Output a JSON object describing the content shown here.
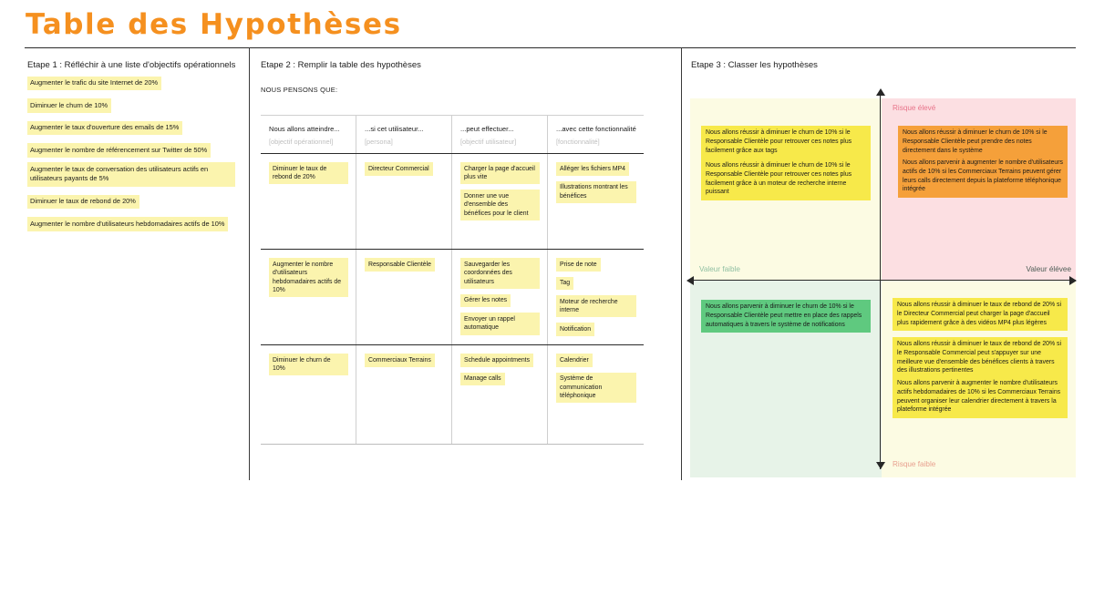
{
  "page": {
    "title": "Table des Hypothèses",
    "title_color": "#f5901f"
  },
  "step1": {
    "heading": "Etape 1 : Réfléchir à une liste d'objectifs opérationnels",
    "goals": [
      "Augmenter le trafic du site Internet de 20%",
      "Diminuer le churn de 10%",
      "Augmenter le taux d'ouverture des emails de 15%",
      "Augmenter le nombre de référencement sur Twitter de 50%",
      "Augmenter le taux de conversation des utilisateurs actifs en utilisateurs payants de 5%",
      "Diminuer le taux de rebond de 20%",
      "Augmenter le nombre d'utilisateurs hebdomadaires actifs de 10%"
    ]
  },
  "step2": {
    "heading": "Etape 2 : Remplir la table des hypothèses",
    "subheading": "NOUS PENSONS QUE:",
    "columns": [
      {
        "main": "Nous allons atteindre...",
        "sub": "[objectif opérationnel]"
      },
      {
        "main": "...si cet utilisateur...",
        "sub": "[persona]"
      },
      {
        "main": "...peut effectuer...",
        "sub": "[objectif utilisateur]"
      },
      {
        "main": "...avec cette fonctionnalité",
        "sub": "[fonctionnalité]"
      }
    ],
    "rows": [
      {
        "objectif": [
          "Diminuer le taux de rebond de 20%"
        ],
        "persona": [
          "Directeur Commercial"
        ],
        "objectif_utilisateur": [
          "Charger la page d'accueil plus vite",
          "Donner une vue d'ensemble des bénéfices pour le client"
        ],
        "fonctionnalite": [
          "Alléger les fichiers MP4",
          "Illustrations montrant les bénéfices"
        ]
      },
      {
        "objectif": [
          "Augmenter le nombre d'utilisateurs hebdomadaires actifs de 10%"
        ],
        "persona": [
          "Responsable Clientèle"
        ],
        "objectif_utilisateur": [
          "Sauvegarder les coordonnées des utilisateurs",
          "Gérer les notes",
          "Envoyer un rappel automatique"
        ],
        "fonctionnalite": [
          "Prise de note",
          "Tag",
          "Moteur de recherche interne",
          "Notification"
        ]
      },
      {
        "objectif": [
          "Diminuer le churn de 10%"
        ],
        "persona": [
          "Commerciaux Terrains"
        ],
        "objectif_utilisateur": [
          "Schedule appointments",
          "Manage calls"
        ],
        "fonctionnalite": [
          "Calendrier",
          "Système de communication téléphonique"
        ]
      }
    ]
  },
  "step3": {
    "heading": "Etape 3 : Classer les hypothèses",
    "axis": {
      "risk_high": "Risque élevé",
      "risk_low": "Risque faible",
      "value_low": "Valeur faible",
      "value_high": "Valeur élévee"
    },
    "quadrants": {
      "top_left": {
        "color": "#fcfbe3",
        "notes": [
          {
            "color": "#f7e94a",
            "text": "Nous allons réussir à diminuer le churn de 10% si le Responsable Clientèle pour retrouver ces notes plus facilement grâce aux tags"
          },
          {
            "color": "#f7e94a",
            "text": "Nous allons réussir à diminuer le churn de 10% si le Responsable Clientèle pour retrouver ces notes plus facilement grâce à un moteur de recherche interne puissant"
          }
        ]
      },
      "top_right": {
        "color": "#fcdfe2",
        "notes": [
          {
            "color": "#f5a03a",
            "text": "Nous allons réussir à diminuer le churn de 10% si le Responsable Clientèle peut prendre des notes directement dans le système"
          },
          {
            "color": "#f5a03a",
            "text": "Nous allons parvenir à augmenter le nombre d'utilisateurs actifs de 10% si les Commerciaux Terrains peuvent gérer leurs calls directement depuis la plateforme téléphonique intégrée"
          }
        ]
      },
      "bottom_left": {
        "color": "#e7f3e8",
        "notes": [
          {
            "color": "#5fc97f",
            "text": "Nous allons parvenir à diminuer le churn de 10% si le Responsable Clientèle peut mettre en place des rappels automatiques à travers le système de notifications"
          }
        ]
      },
      "bottom_right": {
        "color": "#fcfbe3",
        "notes": [
          {
            "color": "#f7e94a",
            "text": "Nous allons réussir à diminuer le taux de rebond de 20% si le Directeur Commercial peut charger la page d'accueil plus rapidement grâce à des vidéos MP4 plus légères"
          },
          {
            "color": "#f7e94a",
            "text": "Nous allons réussir à diminuer le taux de rebond de 20% si le Responsable Commercial peut s'appuyer sur une meilleure vue d'ensemble des bénéfices clients à travers des illustrations pertinentes"
          },
          {
            "color": "#f7e94a",
            "text": "Nous allons parvenir à augmenter le nombre d'utilisateurs actifs hebdomadaires de 10% si les Commerciaux Terrains peuvent organiser leur calendrier directement à travers la plateforme intégrée"
          }
        ]
      }
    }
  }
}
